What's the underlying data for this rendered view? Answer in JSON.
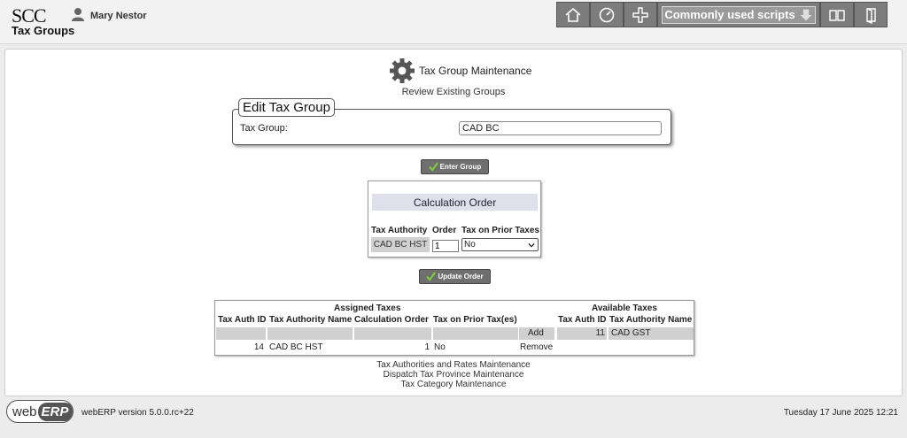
{
  "app": {
    "logo": "SCC",
    "page_title": "Tax Groups",
    "user_name": "Mary Nestor"
  },
  "toolbar": {
    "items": [
      "home-icon",
      "dashboard-icon",
      "plus-icon",
      "commonly-used-scripts",
      "manual-icon",
      "logout-icon"
    ],
    "scripts_label": "Commonly used scripts"
  },
  "heading": {
    "title": "Tax Group Maintenance",
    "subtitle": "Review Existing Groups"
  },
  "edit_group": {
    "legend": "Edit Tax Group",
    "label": "Tax Group:",
    "value": "CAD BC"
  },
  "buttons": {
    "enter_group": "Enter Group",
    "update_order": "Update Order"
  },
  "calculation_order": {
    "title": "Calculation Order",
    "headers": [
      "Tax Authority",
      "Order",
      "Tax on Prior Taxes"
    ],
    "rows": [
      {
        "authority": "CAD BC HST",
        "order": "1",
        "tax_on_prior": "No"
      }
    ]
  },
  "assigned_taxes": {
    "title": "Assigned Taxes",
    "headers": [
      "Tax Auth ID",
      "Tax Authority Name",
      "Calculation Order",
      "Tax on Prior Tax(es)"
    ],
    "rows": [
      {
        "id": "14",
        "name": "CAD BC HST",
        "order": "1",
        "prior": "No",
        "action": "Remove"
      }
    ]
  },
  "available_taxes": {
    "title": "Available Taxes",
    "headers": [
      "Tax Auth ID",
      "Tax Authority Name"
    ],
    "rows": [
      {
        "id": "11",
        "name": "CAD GST",
        "action": "Add"
      }
    ]
  },
  "links": [
    "Tax Authorities and Rates Maintenance",
    "Dispatch Tax Province Maintenance",
    "Tax Category Maintenance"
  ],
  "footer": {
    "logo_web": "web",
    "logo_erp": "ERP",
    "version": "webERP version 5.0.0.rc+22",
    "datetime": "Tuesday 17 June 2025 12:21"
  }
}
